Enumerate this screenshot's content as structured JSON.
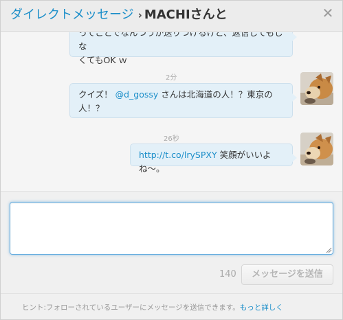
{
  "header": {
    "breadcrumb_link": "ダイレクトメッセージ",
    "separator": "›",
    "conversation_name": "MACHIさんと",
    "close_glyph": "✕"
  },
  "messages": [
    {
      "text_lines": [
        "ってことでなんつうか送りつけるけど、返信してもしな",
        "くてもOK ｗ"
      ],
      "timestamp": ""
    },
    {
      "timestamp": "2分",
      "prefix": "クイズ！ ",
      "mention": "@d_gossy",
      "suffix_line1": " さんは北海道の人！？東京の",
      "line2": "人！？"
    },
    {
      "timestamp": "26秒",
      "link": "http://t.co/lrySPXY",
      "suffix": " 笑顔がいいよね〜。"
    }
  ],
  "composer": {
    "value": "",
    "placeholder": "",
    "char_count": "140",
    "send_label": "メッセージを送信"
  },
  "footer": {
    "hint": "ヒント:フォローされているユーザーにメッセージを送信できます。",
    "more_link": "もっと詳しく"
  },
  "colors": {
    "link_blue": "#1b8ec9",
    "bubble_bg": "#e3f0f8",
    "input_focus": "#68aee0"
  }
}
